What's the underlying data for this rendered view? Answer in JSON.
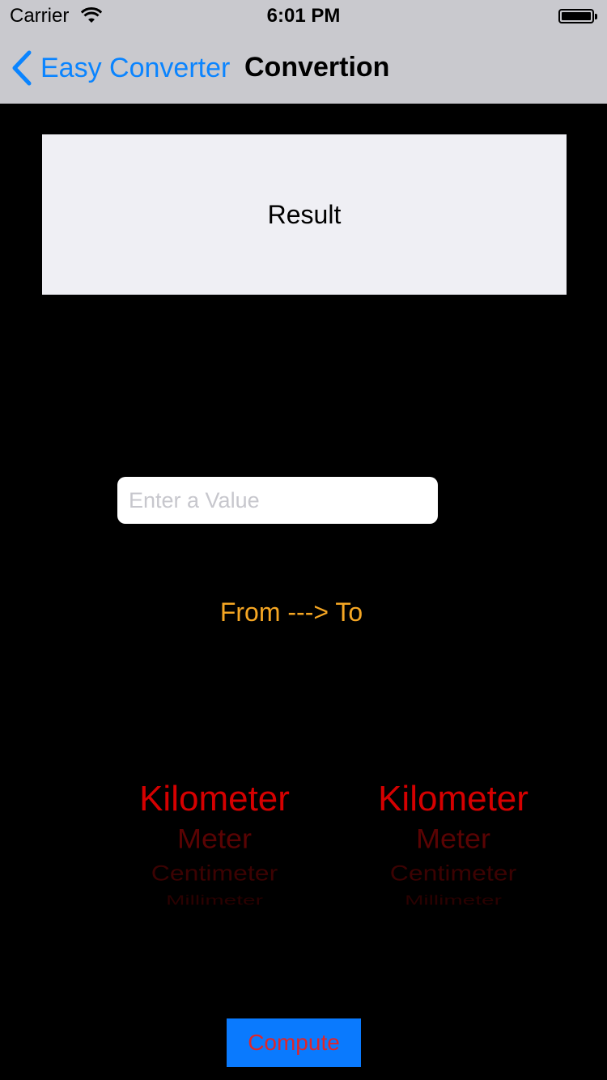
{
  "status_bar": {
    "carrier": "Carrier",
    "time": "6:01 PM",
    "wifi_icon": "wifi-icon",
    "battery_icon": "battery-icon"
  },
  "navbar": {
    "back_label": "Easy Converter",
    "back_icon": "chevron-left-icon",
    "title": "Convertion"
  },
  "result": {
    "label": "Result"
  },
  "input": {
    "placeholder": "Enter a Value",
    "value": ""
  },
  "direction_label": "From ---> To",
  "from_picker": {
    "selected": "Kilometer",
    "options": [
      "Kilometer",
      "Meter",
      "Centimeter",
      "Millimeter"
    ]
  },
  "to_picker": {
    "selected": "Kilometer",
    "options": [
      "Kilometer",
      "Meter",
      "Centimeter",
      "Millimeter"
    ]
  },
  "compute_button": {
    "label": "Compute"
  },
  "colors": {
    "accent": "#0a84ff",
    "navbar_bg": "#c9c9ce",
    "result_bg": "#efeff4",
    "direction_text": "#f5a623",
    "picker_text": "#d50000",
    "compute_bg": "#0a7afe",
    "compute_text": "#e0262a"
  }
}
